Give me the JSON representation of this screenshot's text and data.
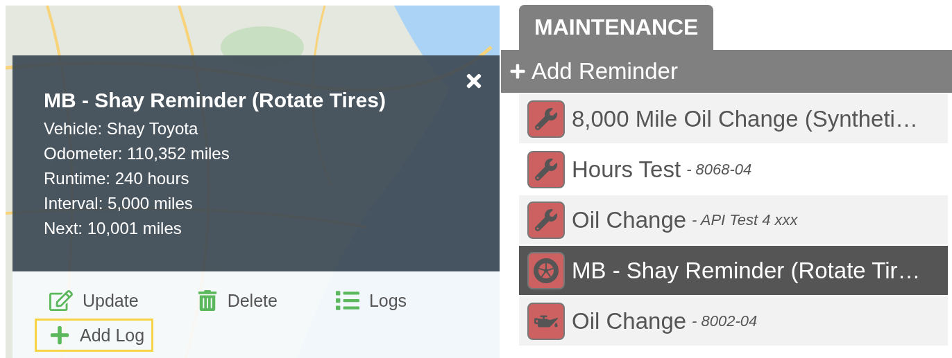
{
  "popup": {
    "title": "MB - Shay Reminder (Rotate Tires)",
    "details": [
      "Vehicle: Shay Toyota",
      "Odometer: 110,352 miles",
      "Runtime: 240 hours",
      "Interval: 5,000 miles",
      "Next: 10,001 miles"
    ],
    "actions": [
      {
        "label": "Update",
        "kind": "edit",
        "highlighted": false
      },
      {
        "label": "Delete",
        "kind": "delete",
        "highlighted": false
      },
      {
        "label": "Logs",
        "kind": "list",
        "highlighted": false
      },
      {
        "label": "Add Log",
        "kind": "add",
        "highlighted": true
      }
    ]
  },
  "maintenance": {
    "tabs": [
      {
        "label": "MAINTENANCE",
        "selected": true
      }
    ],
    "add_button": "Add Reminder",
    "reminders": [
      {
        "name": "8,000 Mile Oil Change (Syntheti…",
        "kind": "wrench",
        "selected": false
      },
      {
        "name": "Hours Test",
        "detail": "- 8068-04",
        "kind": "wrench",
        "selected": false
      },
      {
        "name": "Oil Change",
        "detail": "- API Test 4 xxx",
        "kind": "wrench",
        "selected": false
      },
      {
        "name": "MB - Shay Reminder (Rotate Tir…",
        "kind": "wheel",
        "selected": true
      },
      {
        "name": "Oil Change",
        "detail": "- 8002-04",
        "kind": "oilcan",
        "selected": false
      }
    ]
  }
}
